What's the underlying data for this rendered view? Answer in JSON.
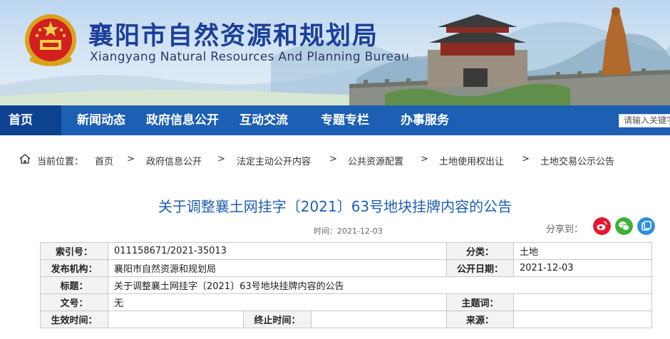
{
  "header": {
    "title": "襄阳市自然资源和规划局",
    "subtitle": "Xiangyang Natural Resources And Planning Bureau",
    "emblem_icon": "national-emblem-icon"
  },
  "nav": {
    "home": "首页",
    "items": [
      "新闻动态",
      "政府信息公开",
      "互动交流",
      "专题专栏",
      "办事服务"
    ],
    "search_placeholder": "请输入关键字"
  },
  "breadcrumb": {
    "prefix": "当前位置：",
    "items": [
      "首页",
      "政府信息公开",
      "法定主动公开内容",
      "公共资源配置",
      "土地使用权出让",
      "土地交易公示公告"
    ],
    "separator": ">"
  },
  "article": {
    "title": "关于调整襄土网挂字〔2021〕63号地块挂牌内容的公告",
    "time_label": "时间：2021-12-03",
    "share_label": "分享到：",
    "share_icons": [
      "weibo-icon",
      "wechat-icon",
      "qzone-icon"
    ]
  },
  "info": {
    "index_label": "索引号：",
    "index_value": "011158671/2021-35013",
    "category_label": "分类：",
    "category_value": "土地",
    "publisher_label": "发布机构：",
    "publisher_value": "襄阳市自然资源和规划局",
    "pubdate_label": "公开日期：",
    "pubdate_value": "2021-12-03",
    "subject_label": "标题：",
    "subject_value": "关于调整襄土网挂字〔2021〕63号地块挂牌内容的公告",
    "docno_label": "文号：",
    "docno_value": "无",
    "keywords_label": "主题词：",
    "keywords_value": "",
    "effective_label": "生效时间：",
    "effective_value": "",
    "expire_label": "终止时间：",
    "expire_value": "",
    "source_label": "来源：",
    "source_value": ""
  },
  "colors": {
    "nav_bg": "#1c5fb3",
    "nav_home_bg": "#0d4290",
    "title_blue": "#1d5fb1",
    "weibo": "#e6162d",
    "wechat": "#3eb135",
    "qzone": "#2d8fe0"
  }
}
